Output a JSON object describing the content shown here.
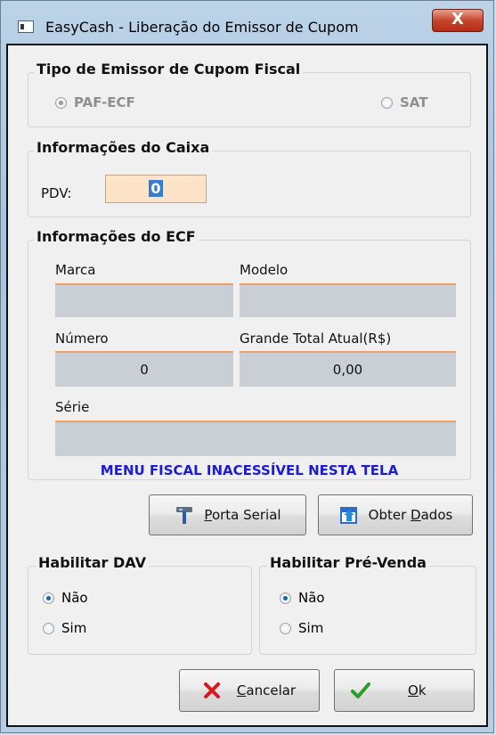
{
  "window": {
    "title": "EasyCash - Liberação do Emissor de Cupom",
    "close_label": "X"
  },
  "emissor": {
    "title": "Tipo de Emissor de Cupom Fiscal",
    "options": [
      {
        "label": "PAF-ECF",
        "selected": true
      },
      {
        "label": "SAT",
        "selected": false
      }
    ]
  },
  "caixa": {
    "title": "Informações do Caixa",
    "pdv_label": "PDV:",
    "pdv_value": "0"
  },
  "ecf": {
    "title": "Informações do ECF",
    "marca_label": "Marca",
    "marca_value": "",
    "modelo_label": "Modelo",
    "modelo_value": "",
    "numero_label": "Número",
    "numero_value": "0",
    "grande_total_label": "Grande Total Atual(R$)",
    "grande_total_value": "0,00",
    "serie_label": "Série",
    "serie_value": "",
    "menu_warning": "MENU FISCAL INACESSÍVEL NESTA TELA"
  },
  "buttons": {
    "porta_serial_prefix": "",
    "porta_serial_accel": "P",
    "porta_serial_rest": "orta Serial",
    "obter_dados_prefix": "Obter ",
    "obter_dados_accel": "D",
    "obter_dados_rest": "ados",
    "cancelar_prefix": "",
    "cancelar_accel": "C",
    "cancelar_rest": "ancelar",
    "ok_prefix": "",
    "ok_accel": "O",
    "ok_rest": "k"
  },
  "dav": {
    "title": "Habilitar DAV",
    "options": [
      {
        "label": "Não",
        "selected": true
      },
      {
        "label": "Sim",
        "selected": false
      }
    ]
  },
  "prevenda": {
    "title": "Habilitar Pré-Venda",
    "options": [
      {
        "label": "Não",
        "selected": true
      },
      {
        "label": "Sim",
        "selected": false
      }
    ]
  },
  "colors": {
    "accent_blue": "#1b1bd8",
    "field_underline": "#f0a060",
    "pdv_bg": "#fde4c9",
    "cancel_red": "#d8181f",
    "ok_green": "#2b9b2b"
  }
}
